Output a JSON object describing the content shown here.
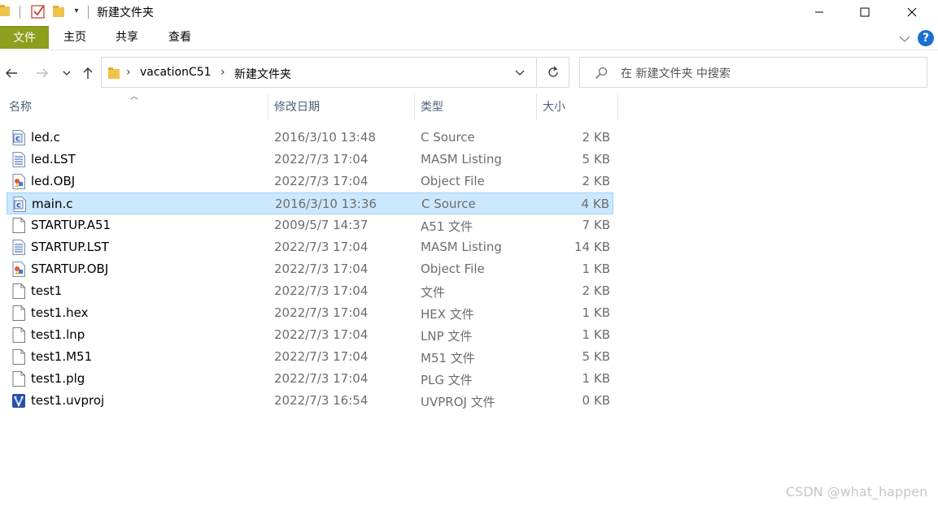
{
  "window": {
    "title": "新建文件夹"
  },
  "ribbon": {
    "tabs": [
      {
        "label": "文件"
      },
      {
        "label": "主页"
      },
      {
        "label": "共享"
      },
      {
        "label": "查看"
      }
    ],
    "accent_color": "#8e9e1d",
    "help_label": "?"
  },
  "address": {
    "breadcrumbs": [
      "vacationC51",
      "新建文件夹"
    ]
  },
  "search": {
    "placeholder": "在 新建文件夹 中搜索"
  },
  "columns": {
    "name": "名称",
    "date": "修改日期",
    "type": "类型",
    "size": "大小"
  },
  "files": [
    {
      "name": "led.c",
      "date": "2016/3/10 13:48",
      "type": "C Source",
      "size": "2 KB",
      "icon": "c-source-file-icon"
    },
    {
      "name": "led.LST",
      "date": "2022/7/3 17:04",
      "type": "MASM Listing",
      "size": "5 KB",
      "icon": "listing-file-icon"
    },
    {
      "name": "led.OBJ",
      "date": "2022/7/3 17:04",
      "type": "Object File",
      "size": "2 KB",
      "icon": "object-file-icon"
    },
    {
      "name": "main.c",
      "date": "2016/3/10 13:36",
      "type": "C Source",
      "size": "4 KB",
      "icon": "c-source-file-icon",
      "selected": true
    },
    {
      "name": "STARTUP.A51",
      "date": "2009/5/7 14:37",
      "type": "A51 文件",
      "size": "7 KB",
      "icon": "blank-file-icon"
    },
    {
      "name": "STARTUP.LST",
      "date": "2022/7/3 17:04",
      "type": "MASM Listing",
      "size": "14 KB",
      "icon": "listing-file-icon"
    },
    {
      "name": "STARTUP.OBJ",
      "date": "2022/7/3 17:04",
      "type": "Object File",
      "size": "1 KB",
      "icon": "object-file-icon"
    },
    {
      "name": "test1",
      "date": "2022/7/3 17:04",
      "type": "文件",
      "size": "2 KB",
      "icon": "blank-file-icon"
    },
    {
      "name": "test1.hex",
      "date": "2022/7/3 17:04",
      "type": "HEX 文件",
      "size": "1 KB",
      "icon": "blank-file-icon"
    },
    {
      "name": "test1.lnp",
      "date": "2022/7/3 17:04",
      "type": "LNP 文件",
      "size": "1 KB",
      "icon": "blank-file-icon"
    },
    {
      "name": "test1.M51",
      "date": "2022/7/3 17:04",
      "type": "M51 文件",
      "size": "5 KB",
      "icon": "blank-file-icon"
    },
    {
      "name": "test1.plg",
      "date": "2022/7/3 17:04",
      "type": "PLG 文件",
      "size": "1 KB",
      "icon": "blank-file-icon"
    },
    {
      "name": "test1.uvproj",
      "date": "2022/7/3 16:54",
      "type": "UVPROJ 文件",
      "size": "0 KB",
      "icon": "uvision-project-icon"
    }
  ],
  "watermark": "CSDN @what_happen"
}
